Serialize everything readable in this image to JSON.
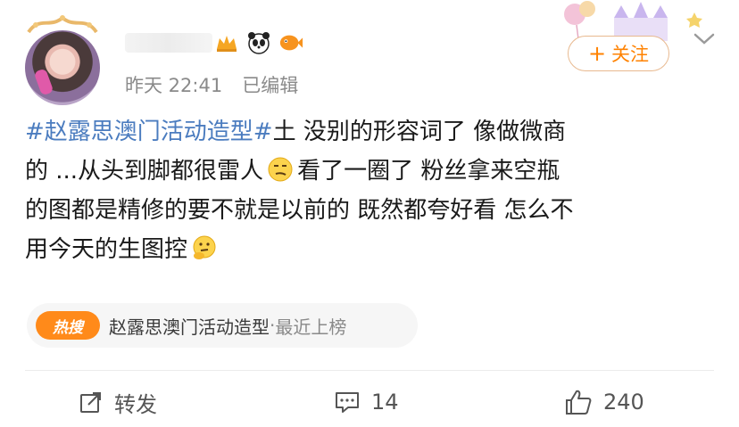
{
  "post": {
    "meta": {
      "time": "昨天 22:41",
      "edited": "已编辑"
    },
    "follow_label": "关注",
    "text_parts": {
      "tag": "#赵露思澳门活动造型#",
      "line1_rest": "土 没别的形容词了 像做微商",
      "line2_a": "的 ...从头到脚都很雷人",
      "line2_b": "看了一圈了 粉丝拿来空瓶",
      "line3": "的图都是精修的要不就是以前的 既然都夸好看 怎么不",
      "line4": "用今天的生图控"
    },
    "topic": {
      "badge": "热搜",
      "name": "赵露思澳门活动造型",
      "separator": "·",
      "status": "最近上榜"
    },
    "actions": {
      "repost_label": "转发",
      "comment_count": "14",
      "like_count": "240"
    },
    "icons": [
      "avatar",
      "vip-crown-icon",
      "panda-badge-icon",
      "fish-badge-icon",
      "chevron-down-icon",
      "smirk-emoji-icon",
      "thinking-emoji-icon",
      "repost-icon",
      "comment-icon",
      "like-icon"
    ],
    "colors": {
      "accent": "#ff8200",
      "tag": "#4b7cbf",
      "meta": "#8a8a8a"
    }
  }
}
